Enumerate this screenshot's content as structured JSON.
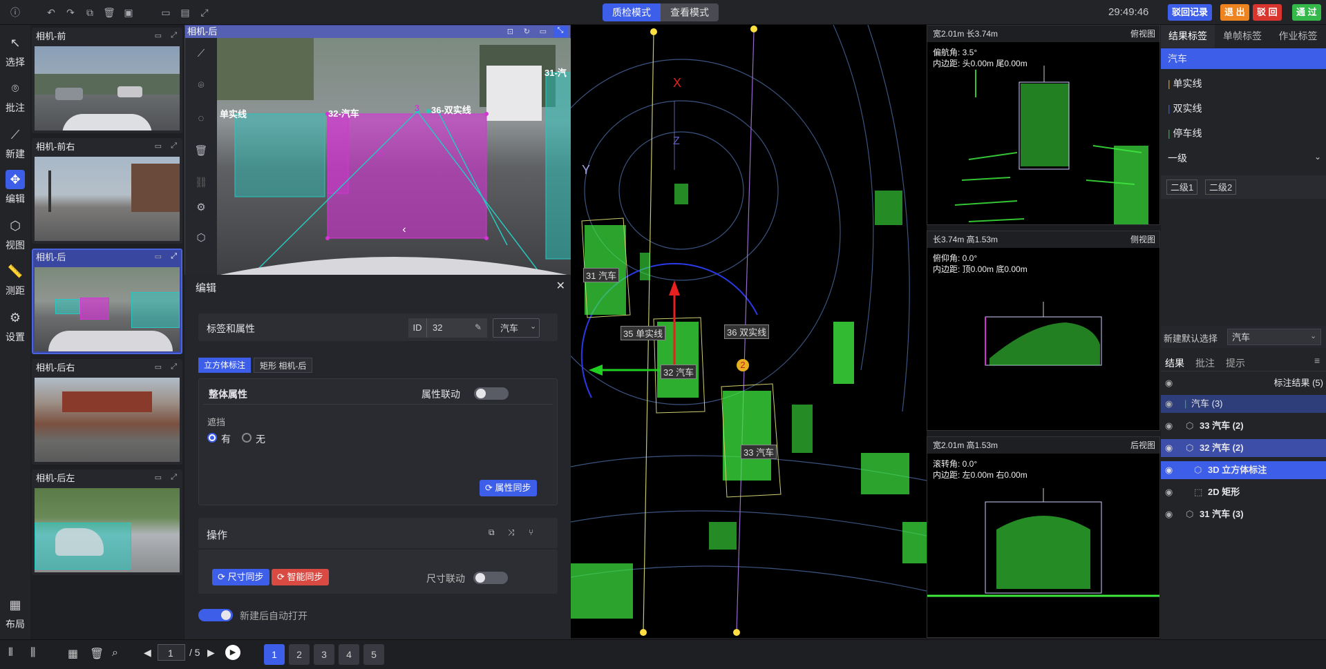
{
  "modes": {
    "qc": "质检模式",
    "view": "查看模式"
  },
  "clock": "29:49:46",
  "top_buttons": {
    "reject_record": "驳回记录",
    "exit": "退 出",
    "reject": "驳 回",
    "pass": "通 过"
  },
  "colors": {
    "accent": "#3d5ee8",
    "reject_record": "#3d5ee8",
    "exit": "#ee8420",
    "reject": "#d9352f",
    "pass": "#34b84a",
    "magenta": "#d633d6",
    "cyan": "#28c8c0",
    "lidar_green": "#3ee83e"
  },
  "tools": [
    {
      "label": "选择",
      "icon": "cursor-icon"
    },
    {
      "label": "批注",
      "icon": "annotate-icon"
    },
    {
      "label": "新建",
      "icon": "polyline-icon"
    },
    {
      "label": "编辑",
      "icon": "move-icon"
    },
    {
      "label": "视图",
      "icon": "cube-icon"
    },
    {
      "label": "测距",
      "icon": "ruler-icon"
    },
    {
      "label": "设置",
      "icon": "gear-icon"
    },
    {
      "label": "布局",
      "icon": "layout-icon"
    }
  ],
  "cameras": [
    "相机-前",
    "相机-前右",
    "相机-后",
    "相机-后右",
    "相机-后左"
  ],
  "main_image": {
    "title": "相机-后",
    "labels": {
      "l1": "单实线",
      "l2": "32-汽车",
      "l3": "3",
      "l4": "36-双实线",
      "l5": "31-汽"
    }
  },
  "edit": {
    "title": "编辑",
    "tag_attr": "标签和属性",
    "id_label": "ID",
    "id_value": "32",
    "class_value": "汽车",
    "tabs": [
      "立方体标注",
      "矩形 相机-后"
    ],
    "overall": "整体属性",
    "attr_link": "属性联动",
    "occlusion": "遮挡",
    "opt_yes": "有",
    "opt_no": "无",
    "attr_sync": "属性同步",
    "ops": "操作",
    "size_sync": "尺寸同步",
    "smart_sync": "智能同步",
    "size_link": "尺寸联动",
    "auto_open": "新建后自动打开"
  },
  "lidar": {
    "axis_x": "X",
    "axis_y": "Y",
    "axis_z": "Z",
    "boxes": [
      "31 汽车",
      "35 单实线",
      "32 汽车",
      "36 双实线",
      "33 汽车"
    ],
    "marker": "2"
  },
  "views": [
    {
      "name": "俯视图",
      "dims": "宽2.01m  长3.74m",
      "line1": "偏航角: 3.5°",
      "line2": "内边距:  头0.00m  尾0.00m"
    },
    {
      "name": "侧视图",
      "dims": "长3.74m  高1.53m",
      "line1": "俯仰角: 0.0°",
      "line2": "内边距:  顶0.00m  底0.00m"
    },
    {
      "name": "后视图",
      "dims": "宽2.01m  高1.53m",
      "line1": "滚转角: 0.0°",
      "line2": "内边距:  左0.00m  右0.00m"
    }
  ],
  "right": {
    "tabs": [
      "结果标签",
      "单帧标签",
      "作业标签"
    ],
    "labels": [
      "汽车",
      "单实线",
      "双实线",
      "停车线"
    ],
    "label_colors": [
      "#3d5ee8",
      "#e8a020",
      "#3d5ee8",
      "#34b84a"
    ],
    "level1": "一级",
    "level2": [
      "二级1",
      "二级2"
    ],
    "default_select": "新建默认选择",
    "default_value": "汽车",
    "result_tabs": [
      "结果",
      "批注",
      "提示"
    ],
    "result_title": "标注结果 (5)",
    "tree": [
      {
        "text": "汽车 (3)",
        "indent": 0
      },
      {
        "text": "33 汽车 (2)",
        "indent": 1
      },
      {
        "text": "32 汽车 (2)",
        "indent": 1
      },
      {
        "text": "3D 立方体标注",
        "indent": 2
      },
      {
        "text": "2D 矩形",
        "indent": 2
      },
      {
        "text": "31 汽车 (3)",
        "indent": 1
      }
    ]
  },
  "pager": {
    "current": "1",
    "total": "/ 5",
    "pages": [
      "1",
      "2",
      "3",
      "4",
      "5"
    ]
  }
}
